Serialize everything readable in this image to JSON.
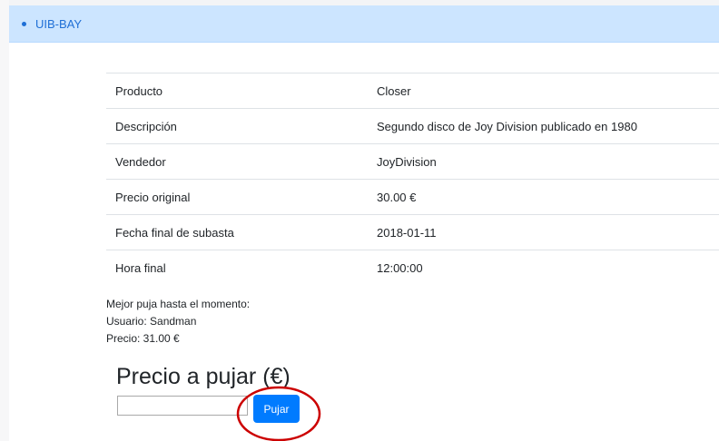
{
  "navbar": {
    "brand": "UIB-BAY"
  },
  "product_table": [
    {
      "label": "Producto",
      "value": "Closer"
    },
    {
      "label": "Descripción",
      "value": "Segundo disco de Joy Division publicado en 1980"
    },
    {
      "label": "Vendedor",
      "value": "JoyDivision"
    },
    {
      "label": "Precio original",
      "value": "30.00 €"
    },
    {
      "label": "Fecha final de subasta",
      "value": "2018-01-11"
    },
    {
      "label": "Hora final",
      "value": "12:00:00"
    }
  ],
  "best_bid": {
    "heading": "Mejor puja hasta el momento:",
    "user": "Usuario: Sandman",
    "price": "Precio: 31.00 €"
  },
  "bid_form": {
    "title": "Precio a pujar (€)",
    "input_value": "",
    "button_label": "Pujar"
  },
  "annotation": {
    "color": "#cc0000"
  }
}
